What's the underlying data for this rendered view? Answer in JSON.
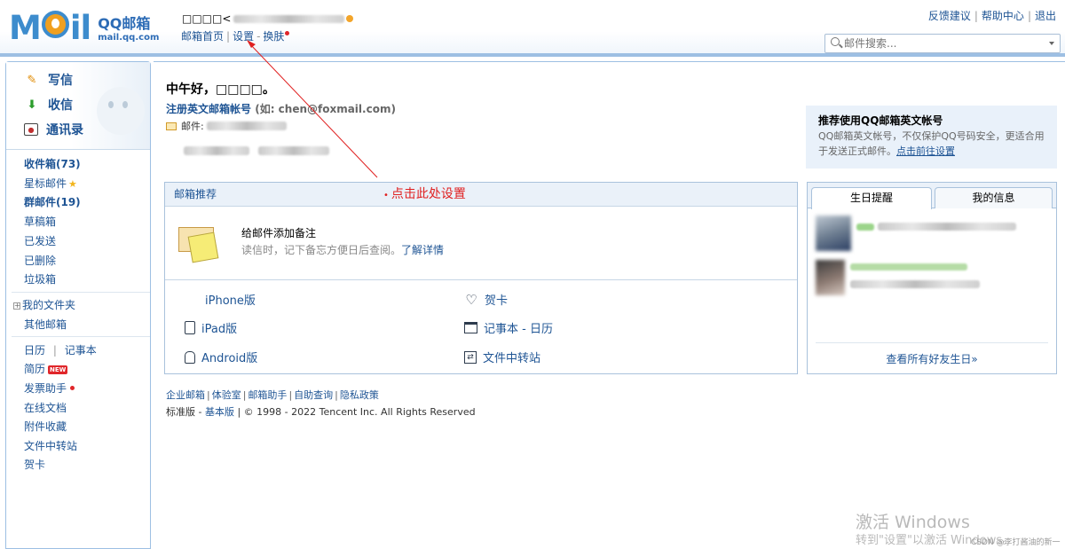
{
  "header": {
    "logo_title": "QQ邮箱",
    "logo_sub": "mail.qq.com",
    "user_prefix": "□□□□<",
    "links": [
      "邮箱首页",
      "设置",
      "换肤"
    ],
    "link_seps": [
      "|",
      "-"
    ],
    "right_links": [
      "反馈建议",
      "帮助中心",
      "退出"
    ],
    "search_placeholder": "邮件搜索..."
  },
  "sidebar": {
    "actions": [
      "写信",
      "收信",
      "通讯录"
    ],
    "folders": {
      "inbox": "收件箱(73)",
      "starred": "星标邮件",
      "group": "群邮件(19)",
      "drafts": "草稿箱",
      "sent": "已发送",
      "deleted": "已删除",
      "spam": "垃圾箱",
      "my_folders": "我的文件夹",
      "other_mailbox": "其他邮箱"
    },
    "tools": {
      "calendar": "日历",
      "sep": "|",
      "notes": "记事本",
      "resume": "简历",
      "new_badge": "NEW",
      "invoice": "发票助手",
      "online_docs": "在线文档",
      "attachments": "附件收藏",
      "file_transfer": "文件中转站",
      "cards": "贺卡"
    }
  },
  "main": {
    "greeting": "中午好，□□□□。",
    "register_link": "注册英文邮箱帐号",
    "register_example": "(如: chen@foxmail.com)",
    "mail_label": "邮件:",
    "recommend": {
      "title": "推荐使用QQ邮箱英文帐号",
      "desc": "QQ邮箱英文帐号，不仅保护QQ号码安全，更适合用于发送正式邮件。",
      "link": "点击前往设置"
    },
    "panel": {
      "title": "邮箱推荐",
      "annotation": "点击此处设置",
      "note_title": "给邮件添加备注",
      "note_desc": "读信时，记下备忘方便日后查阅。",
      "note_link": "了解详情",
      "apps": [
        "iPhone版",
        "iPad版",
        "Android版",
        "贺卡",
        "记事本 - 日历",
        "文件中转站"
      ]
    },
    "footer_links": [
      "企业邮箱",
      "体验室",
      "邮箱助手",
      "自助查询",
      "隐私政策"
    ],
    "copyright_prefix": "标准版 - ",
    "copyright_link": "基本版",
    "copyright_text": " | © 1998 - 2022 Tencent Inc. All Rights Reserved"
  },
  "birthday": {
    "tabs": [
      "生日提醒",
      "我的信息"
    ],
    "view_all": "查看所有好友生日»"
  },
  "watermark": {
    "line1": "激活 Windows",
    "line2": "转到\"设置\"以激活 Windows。",
    "csdn": "CSDN @李打酱油的新一"
  },
  "colors": {
    "link": "#1e5494",
    "accent_border": "#9dbfe3",
    "annotation_red": "#e02020"
  }
}
